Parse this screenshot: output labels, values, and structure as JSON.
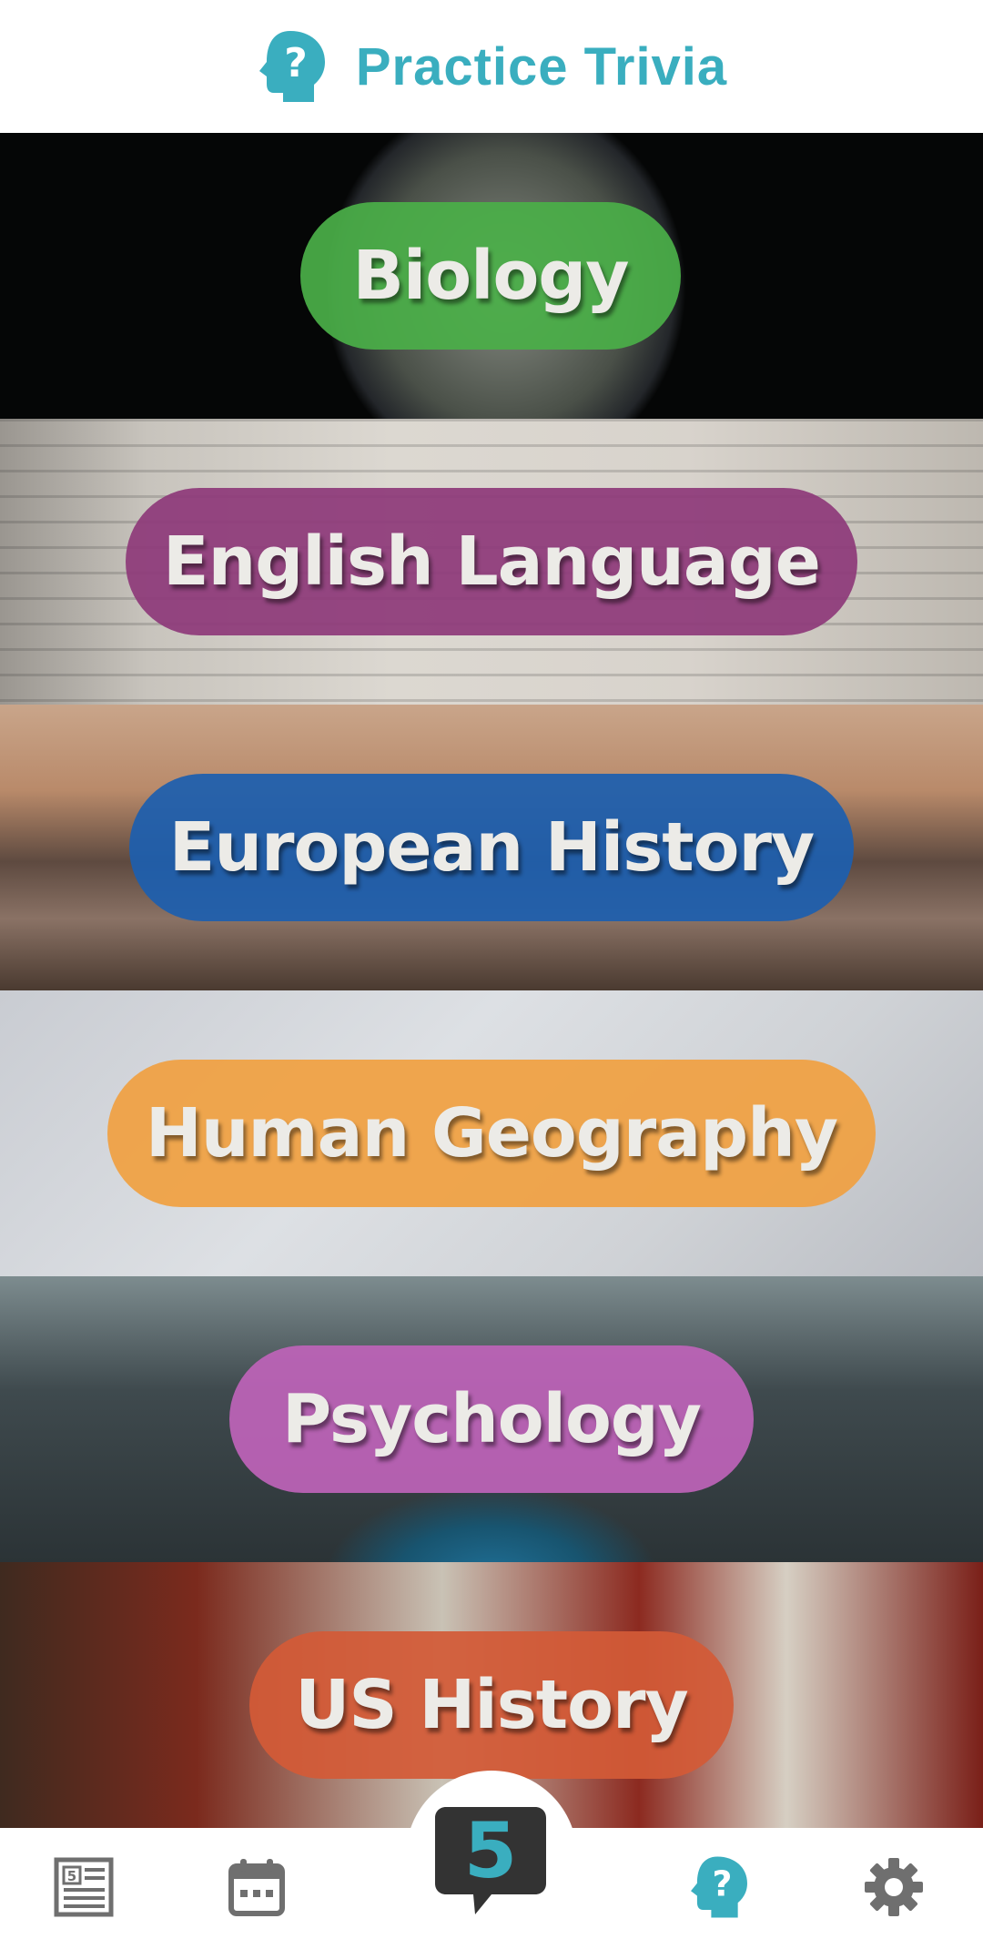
{
  "header": {
    "title": "Practice Trivia",
    "icon": "head-question-icon",
    "color": "#3aaebf"
  },
  "categories": [
    {
      "label": "Biology",
      "color": "#4aae48",
      "background": "petri-dish-photo"
    },
    {
      "label": "English Language",
      "color": "#8e3a7a",
      "background": "dictionary-photo"
    },
    {
      "label": "European History",
      "color": "#1d5fae",
      "background": "bridge-river-photo"
    },
    {
      "label": "Human Geography",
      "color": "#f0a042",
      "background": "map-pin-photo"
    },
    {
      "label": "Psychology",
      "color": "#bd63b8",
      "background": "eye-photo"
    },
    {
      "label": "US History",
      "color": "#d35a37",
      "background": "redcoats-photo"
    }
  ],
  "bottom_nav": {
    "items": [
      {
        "name": "news",
        "icon": "newspaper-icon"
      },
      {
        "name": "calendar",
        "icon": "calendar-icon"
      },
      {
        "name": "home",
        "icon": "five-speech-bubble-logo",
        "digit": "5"
      },
      {
        "name": "trivia",
        "icon": "head-question-icon",
        "active": true
      },
      {
        "name": "settings",
        "icon": "gear-icon"
      }
    ],
    "active_color": "#3aaebf",
    "inactive_color": "#6f6f6f"
  }
}
